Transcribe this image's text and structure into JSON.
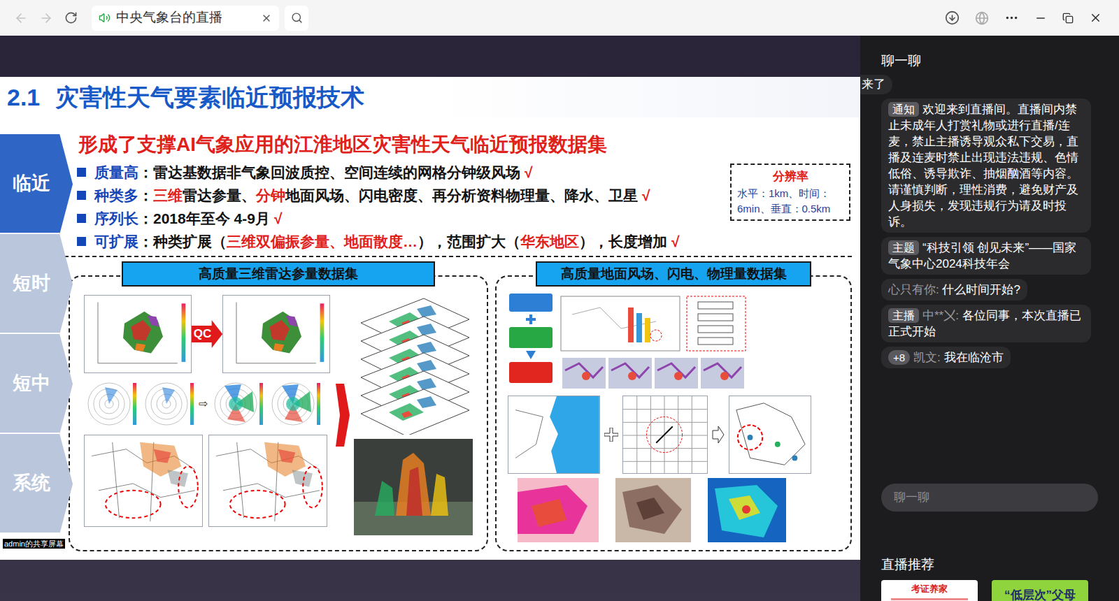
{
  "browser": {
    "tab_title": "中央气象台的直播"
  },
  "slide": {
    "section_number": "2.1",
    "title": "灾害性天气要素临近预报技术",
    "nav": [
      {
        "label": "临近",
        "selected": true
      },
      {
        "label": "短时",
        "selected": false
      },
      {
        "label": "短中",
        "selected": false
      },
      {
        "label": "系统",
        "selected": false
      }
    ],
    "heading": "形成了支撑AI气象应用的江淮地区灾害性天气临近预报数据集",
    "bullets": [
      {
        "label": "质量高",
        "segments": [
          {
            "text": "：雷达基数据非气象回波质控、空间连续的网格分钟级风场",
            "emphasis": false
          }
        ],
        "check": "√"
      },
      {
        "label": "种类多",
        "segments": [
          {
            "text": "：",
            "emphasis": false
          },
          {
            "text": "三维",
            "emphasis": true
          },
          {
            "text": "雷达参量、",
            "emphasis": false
          },
          {
            "text": "分钟",
            "emphasis": true
          },
          {
            "text": "地面风场、闪电密度、再分析资料物理量、降水、卫星",
            "emphasis": false
          }
        ],
        "check": "√"
      },
      {
        "label": "序列长",
        "segments": [
          {
            "text": "：2018年至今 4-9月",
            "emphasis": false
          }
        ],
        "check": "√"
      },
      {
        "label": "可扩展",
        "segments": [
          {
            "text": "：种类扩展（",
            "emphasis": false
          },
          {
            "text": "三维双偏振参量、地面散度…",
            "emphasis": true
          },
          {
            "text": "），范围扩大（",
            "emphasis": false
          },
          {
            "text": "华东地区",
            "emphasis": true
          },
          {
            "text": "），长度增加",
            "emphasis": false
          }
        ],
        "check": "√"
      }
    ],
    "resolution": {
      "title": "分辨率",
      "lines": [
        "水平：1km、时间：",
        "6min、垂直：0.5km"
      ]
    },
    "panels": [
      {
        "title": "高质量三维雷达参量数据集"
      },
      {
        "title": "高质量地面风场、闪电、物理量数据集"
      }
    ],
    "qc_label": "QC"
  },
  "share_label": "admin的共享屏幕",
  "chat": {
    "header": "聊一聊",
    "cut_message": "来了",
    "messages": [
      {
        "kind": "notice",
        "tag": "通知",
        "text": "欢迎来到直播间。直播间内禁止未成年人打赏礼物或进行直播/连麦，禁止主播诱导观众私下交易，直播及连麦时禁止出现违法违规、色情低俗、诱导欺诈、抽烟酗酒等内容。请谨慎判断，理性消费，避免财产及人身损失，发现违规行为请及时投诉。"
      },
      {
        "kind": "notice",
        "tag": "主题",
        "text": "“科技引领 创见未来”——国家气象中心2024科技年会"
      },
      {
        "kind": "user",
        "name": "心只有你:",
        "text": "什么时间开始?"
      },
      {
        "kind": "host",
        "tag": "主播",
        "name": "中**〤:",
        "text": "各位同事，本次直播已正式开始"
      },
      {
        "kind": "badge",
        "badge": "+8",
        "name": "凯文:",
        "text": "我在临沧市"
      }
    ],
    "input_placeholder": "聊一聊",
    "recommend_title": "直播推荐",
    "recommendations": [
      {
        "title": "考证养家",
        "color": "#ffffff"
      },
      {
        "title": "“低层次”父母",
        "color": "#8fd43c"
      }
    ]
  }
}
